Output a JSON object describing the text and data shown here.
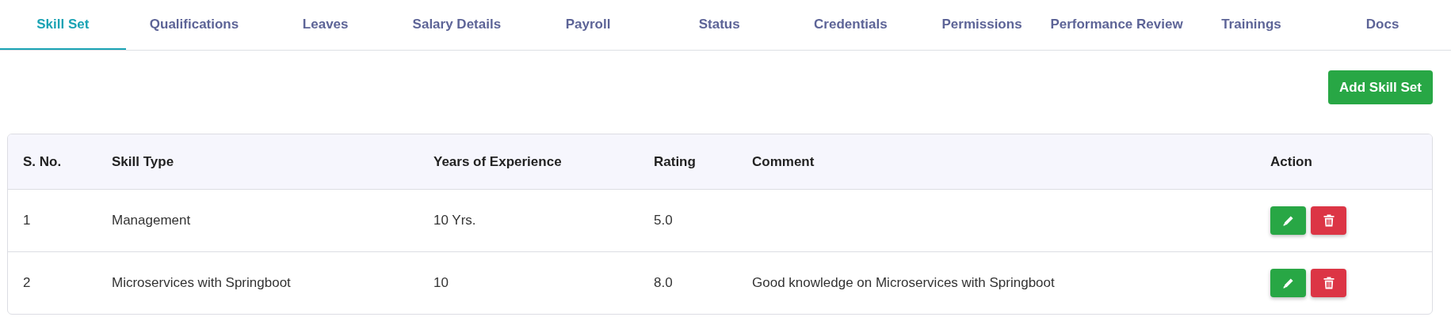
{
  "tabs": [
    {
      "label": "Skill Set",
      "selected": true
    },
    {
      "label": "Qualifications",
      "selected": false
    },
    {
      "label": "Leaves",
      "selected": false
    },
    {
      "label": "Salary Details",
      "selected": false
    },
    {
      "label": "Payroll",
      "selected": false
    },
    {
      "label": "Status",
      "selected": false
    },
    {
      "label": "Credentials",
      "selected": false
    },
    {
      "label": "Permissions",
      "selected": false
    },
    {
      "label": "Performance Review",
      "selected": false
    },
    {
      "label": "Trainings",
      "selected": false
    },
    {
      "label": "Docs",
      "selected": false
    }
  ],
  "add_button": {
    "label": "Add Skill Set"
  },
  "table": {
    "columns": [
      "S. No.",
      "Skill Type",
      "Years of Experience",
      "Rating",
      "Comment",
      "Action"
    ],
    "rows": [
      {
        "s_no": "1",
        "skill_type": "Management",
        "years": "10 Yrs.",
        "rating": "5.0"
      },
      {
        "s_no": "2",
        "skill_type": "Microservices with Springboot",
        "years": "10",
        "rating": "8.0",
        "comment": "Good knowledge on Microservices with Springboot"
      }
    ]
  }
}
